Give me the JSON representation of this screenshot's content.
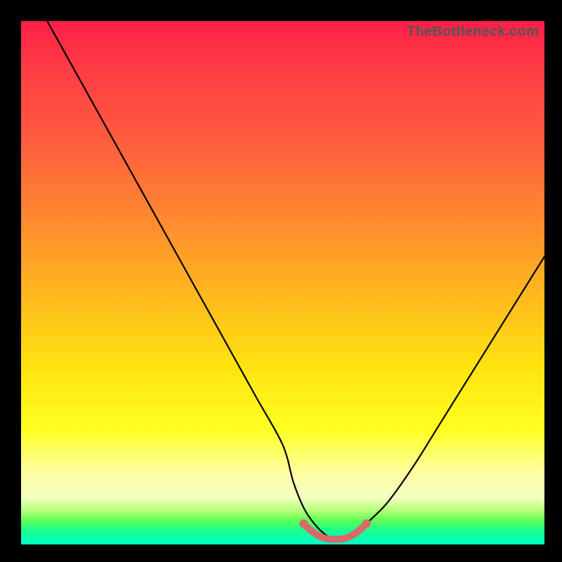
{
  "watermark": "TheBottleneck.com",
  "chart_data": {
    "type": "line",
    "title": "",
    "xlabel": "",
    "ylabel": "",
    "xlim": [
      0,
      100
    ],
    "ylim": [
      0,
      100
    ],
    "grid": false,
    "legend": false,
    "annotations": [],
    "series": [
      {
        "name": "main-curve",
        "color": "#000000",
        "x": [
          5,
          10,
          15,
          20,
          25,
          30,
          35,
          40,
          45,
          50,
          52,
          54,
          56,
          58,
          60,
          62,
          64,
          66,
          70,
          75,
          80,
          85,
          90,
          95,
          100
        ],
        "y": [
          100,
          91,
          82,
          73,
          64,
          55,
          46,
          37,
          28,
          19,
          12,
          7,
          4,
          2,
          1,
          1,
          2,
          4,
          8,
          15,
          23,
          31,
          39,
          47,
          55
        ]
      },
      {
        "name": "sweet-spot-marker",
        "color": "#e06a6a",
        "x": [
          54,
          55,
          56,
          57,
          58,
          59,
          60,
          61,
          62,
          63,
          64,
          65,
          66
        ],
        "y": [
          4.0,
          3.0,
          2.2,
          1.6,
          1.2,
          1.0,
          1.0,
          1.0,
          1.2,
          1.6,
          2.2,
          3.0,
          4.0
        ]
      }
    ]
  }
}
